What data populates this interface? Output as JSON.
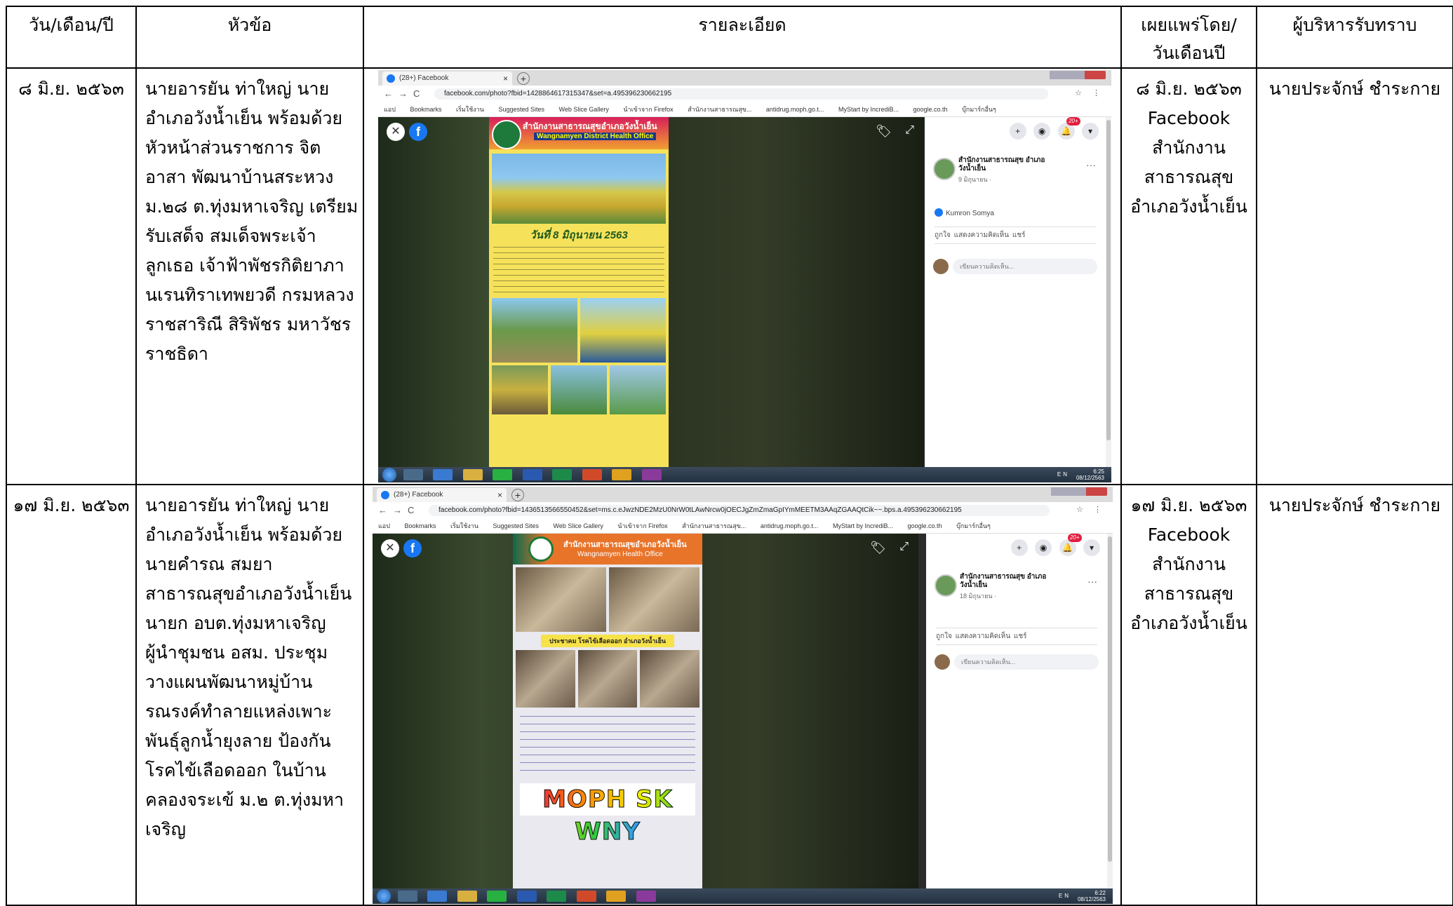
{
  "headers": {
    "date": "วัน/เดือน/ปี",
    "topic": "หัวข้อ",
    "detail": "รายละเอียด",
    "published_line1": "เผยแพร่โดย/",
    "published_line2": "วันเดือนปี",
    "executive": "ผู้บริหารรับทราบ"
  },
  "rows": [
    {
      "date": "๘ มิ.ย. ๒๕๖๓",
      "topic": "นายอารยัน ท่าใหญ่ นายอำเภอวังน้ำเย็น พร้อมด้วย หัวหน้าส่วนราชการ จิตอาสา พัฒนาบ้านสระหวง ม.๒๘ ต.ทุ่งมหาเจริญ เตรียมรับเสด็จ สมเด็จพระเจ้าลูกเธอ เจ้าฟ้าพัชรกิติยาภา นเรนทิราเทพยวดี กรมหลวงราชสาริณี สิริพัชร มหาวัชรราชธิดา",
      "published_date": "๘ มิ.ย. ๒๕๖๓",
      "published_by": "Facebook",
      "published_org1": "สำนักงาน",
      "published_org2": "สาธารณสุข",
      "published_org3": "อำเภอวังน้ำเย็น",
      "executive": "นายประจักษ์ ชำระกาย",
      "shot": {
        "tab_title": "(28+) Facebook",
        "url": "facebook.com/photo?fbid=1428864617315347&set=a.495396230662195",
        "bookmarks": [
          "แอป",
          "Bookmarks",
          "เริ่มใช้งาน",
          "Suggested Sites",
          "Web Slice Gallery",
          "นำเข้าจาก Firefox",
          "สำนักงานสาธารณสุข...",
          "antidrug.moph.go.t...",
          "MyStart by IncrediB...",
          "google.co.th",
          "บุ๊กมาร์กอื่นๆ"
        ],
        "page_name": "สำนักงานสาธารณสุข อำเภอวังน้ำเย็น",
        "post_date": "9 มิถุนายน · ",
        "liker": "Kumron Somya",
        "actions": "ถูกใจ   แสดงความคิดเห็น   แชร์",
        "comment_placeholder": "เขียนความคิดเห็น...",
        "badge": "20+",
        "poster_title": "สำนักงานสาธารณสุขอำเภอวังน้ำเย็น",
        "poster_sub": "Wangnamyen District Health Office",
        "poster_date": "วันที่ 8 มิถุนายน 2563",
        "tray_lang": "EN",
        "tray_time": "6:25",
        "tray_date": "08/12/2563"
      }
    },
    {
      "date": "๑๗ มิ.ย. ๒๕๖๓",
      "topic": "นายอารยัน ท่าใหญ่ นายอำเภอวังน้ำเย็น พร้อมด้วย นายคำรณ สมยา สาธารณสุขอำเภอวังน้ำเย็น นายก อบต.ทุ่งมหาเจริญ ผู้นำชุมชน อสม. ประชุมวางแผนพัฒนาหมู่บ้าน รณรงค์ทำลายแหล่งเพาะพันธุ์ลูกน้ำยุงลาย ป้องกันโรคไข้เลือดออก ในบ้านคลองจระเข้ ม.๒ ต.ทุ่งมหาเจริญ",
      "published_date": "๑๗ มิ.ย. ๒๕๖๓",
      "published_by": "Facebook",
      "published_org1": "สำนักงาน",
      "published_org2": "สาธารณสุข",
      "published_org3": "อำเภอวังน้ำเย็น",
      "executive": "นายประจักษ์ ชำระกาย",
      "shot": {
        "tab_title": "(28+) Facebook",
        "url": "facebook.com/photo?fbid=1436513566550452&set=ms.c.eJwzNDE2MzU0NrW0tLAwNrcw0jOECJgZmZmaGpIYmMEETM3AAqZGAAQtCik~~.bps.a.495396230662195",
        "bookmarks": [
          "แอป",
          "Bookmarks",
          "เริ่มใช้งาน",
          "Suggested Sites",
          "Web Slice Gallery",
          "นำเข้าจาก Firefox",
          "สำนักงานสาธารณสุข...",
          "antidrug.moph.go.t...",
          "MyStart by IncrediB...",
          "google.co.th",
          "บุ๊กมาร์กอื่นๆ"
        ],
        "page_name": "สำนักงานสาธารณสุข อำเภอวังน้ำเย็น",
        "post_date": "18 มิถุนายน · ",
        "actions": "ถูกใจ   แสดงความคิดเห็น   แชร์",
        "comment_placeholder": "เขียนความคิดเห็น...",
        "badge": "20+",
        "poster_title": "สำนักงานสาธารณสุขอำเภอวังน้ำเย็น",
        "poster_sub": "Wangnamyen Health Office",
        "poster_banner": "ประชาคม โรคไข้เลือดออก อำเภอวังน้ำเย็น",
        "poster_footer": "MOPH SK WNY",
        "tray_lang": "EN",
        "tray_time": "6:22",
        "tray_date": "08/12/2563"
      }
    }
  ]
}
